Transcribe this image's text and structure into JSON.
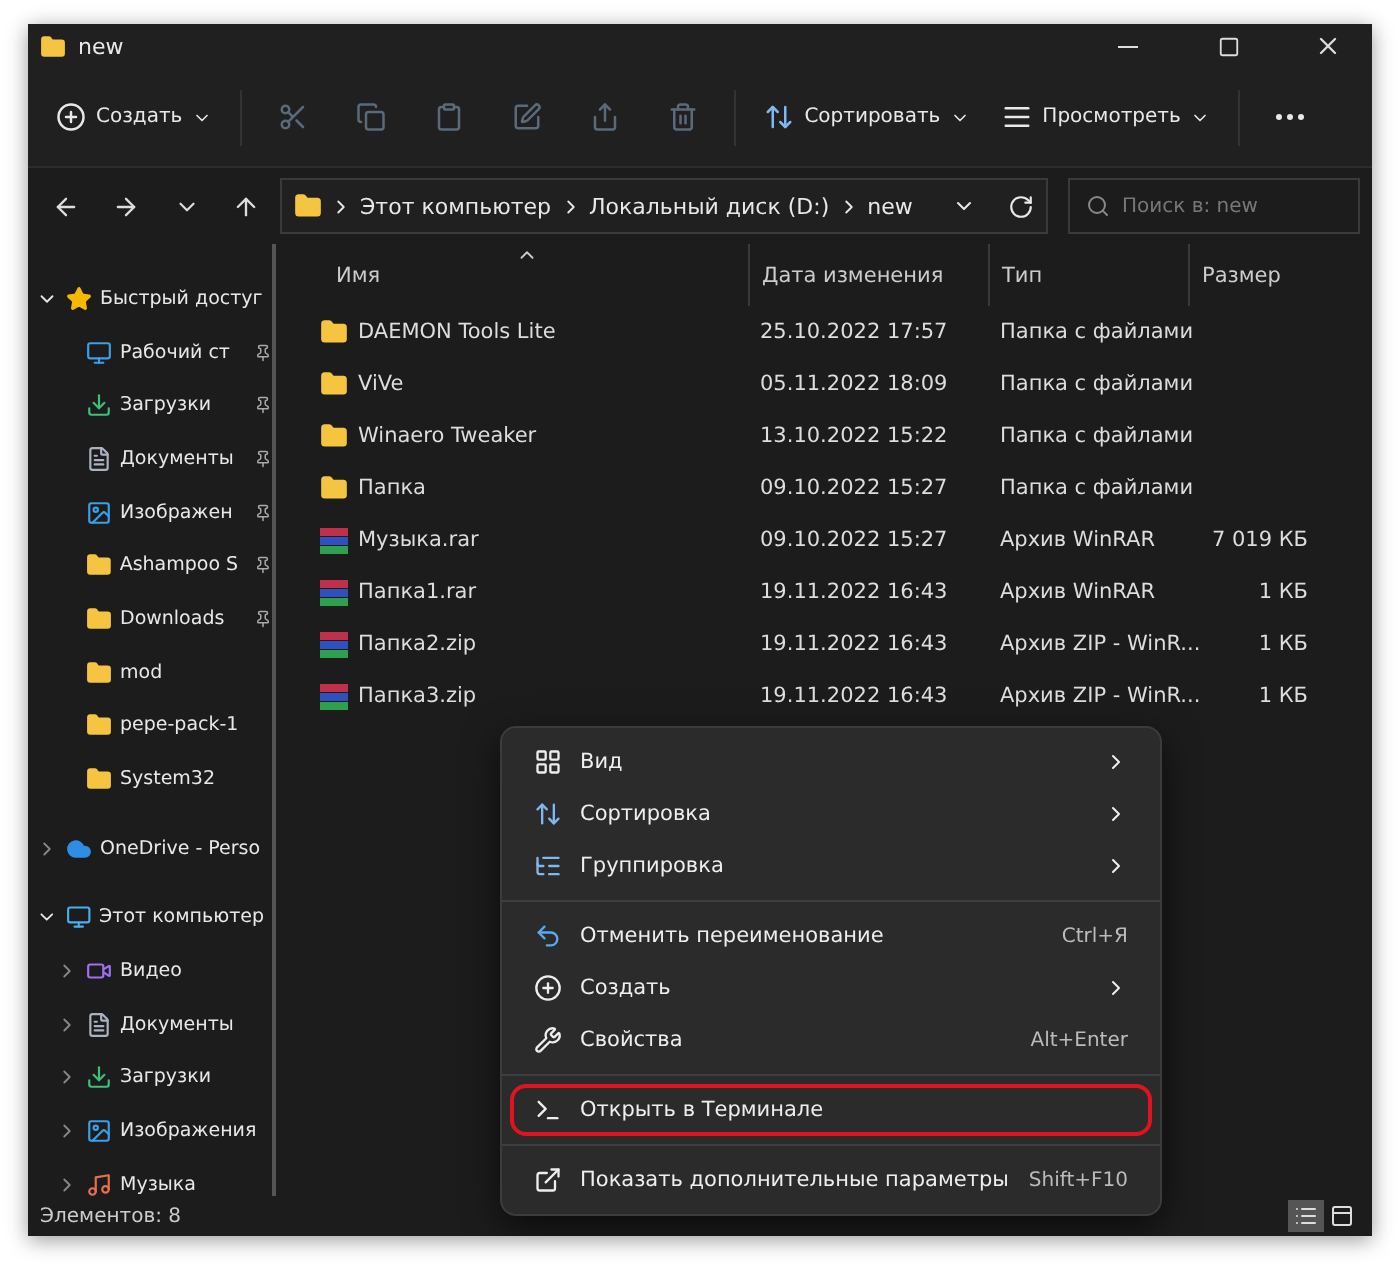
{
  "window": {
    "title": "new"
  },
  "toolbar": [
    {
      "kind": "new",
      "label": "Создать",
      "dropdown": true,
      "disabled": false
    },
    {
      "kind": "cut",
      "disabled": true
    },
    {
      "kind": "copy",
      "disabled": true
    },
    {
      "kind": "paste",
      "disabled": true
    },
    {
      "kind": "rename",
      "disabled": true
    },
    {
      "kind": "share",
      "disabled": true
    },
    {
      "kind": "delete",
      "disabled": true
    },
    {
      "kind": "sort",
      "label": "Сортировать",
      "dropdown": true,
      "disabled": false
    },
    {
      "kind": "view",
      "label": "Просмотреть",
      "dropdown": true,
      "disabled": false
    },
    {
      "kind": "more",
      "disabled": false
    }
  ],
  "address": {
    "path": [
      "Этот компьютер",
      "Локальный диск (D:)",
      "new"
    ],
    "search_placeholder": "Поиск в: new"
  },
  "sidebar": {
    "items": [
      {
        "kind": "star",
        "label": "Быстрый достуг",
        "expanded": true,
        "children": [
          {
            "kind": "desktop",
            "label": "Рабочий ст",
            "pinned": true
          },
          {
            "kind": "download",
            "label": "Загрузки",
            "pinned": true
          },
          {
            "kind": "documents",
            "label": "Документы",
            "pinned": true
          },
          {
            "kind": "pictures",
            "label": "Изображен",
            "pinned": true
          },
          {
            "kind": "folder",
            "label": "Ashampoo S",
            "pinned": true
          },
          {
            "kind": "folder",
            "label": "Downloads",
            "pinned": true
          },
          {
            "kind": "folder",
            "label": "mod",
            "pinned": false
          },
          {
            "kind": "folder",
            "label": "pepe-pack-1",
            "pinned": false
          },
          {
            "kind": "folder",
            "label": "System32",
            "pinned": false
          }
        ]
      },
      {
        "kind": "onedrive",
        "label": "OneDrive - Perso",
        "expanded": false
      },
      {
        "kind": "pc",
        "label": "Этот компьютер",
        "expanded": true,
        "children": [
          {
            "kind": "video",
            "label": "Видео",
            "expanded": false
          },
          {
            "kind": "documents",
            "label": "Документы",
            "expanded": false
          },
          {
            "kind": "download",
            "label": "Загрузки",
            "expanded": false
          },
          {
            "kind": "pictures",
            "label": "Изображения",
            "expanded": false
          },
          {
            "kind": "music",
            "label": "Музыка",
            "expanded": false
          }
        ]
      }
    ]
  },
  "table": {
    "columns": [
      "Имя",
      "Дата изменения",
      "Тип",
      "Размер"
    ],
    "rows": [
      {
        "kind": "folder",
        "name": "DAEMON Tools Lite",
        "date": "25.10.2022 17:57",
        "type": "Папка с файлами"
      },
      {
        "kind": "folder",
        "name": "ViVe",
        "date": "05.11.2022 18:09",
        "type": "Папка с файлами"
      },
      {
        "kind": "folder",
        "name": "Winaero Tweaker",
        "date": "13.10.2022 15:22",
        "type": "Папка с файлами"
      },
      {
        "kind": "folder",
        "name": "Папка",
        "date": "09.10.2022 15:27",
        "type": "Папка с файлами"
      },
      {
        "kind": "archive",
        "name": "Музыка.rar",
        "date": "09.10.2022 15:27",
        "type": "Архив WinRAR",
        "size": "7 019 КБ"
      },
      {
        "kind": "archive",
        "name": "Папка1.rar",
        "date": "19.11.2022 16:43",
        "type": "Архив WinRAR",
        "size": "1 КБ"
      },
      {
        "kind": "archive",
        "name": "Папка2.zip",
        "date": "19.11.2022 16:43",
        "type": "Архив ZIP - WinR...",
        "size": "1 КБ"
      },
      {
        "kind": "archive",
        "name": "Папка3.zip",
        "date": "19.11.2022 16:43",
        "type": "Архив ZIP - WinR...",
        "size": "1 КБ"
      }
    ]
  },
  "context_menu": {
    "groups": [
      [
        {
          "kind": "view",
          "label": "Вид",
          "submenu": true,
          "highlighted": false
        },
        {
          "kind": "sort",
          "label": "Сортировка",
          "submenu": true,
          "highlighted": false
        },
        {
          "kind": "group",
          "label": "Группировка",
          "submenu": true,
          "highlighted": false
        }
      ],
      [
        {
          "kind": "undo",
          "label": "Отменить переименование",
          "shortcut": "Ctrl+Я",
          "submenu": false,
          "highlighted": false
        },
        {
          "kind": "new",
          "label": "Создать",
          "submenu": true,
          "highlighted": false
        },
        {
          "kind": "properties",
          "label": "Свойства",
          "shortcut": "Alt+Enter",
          "submenu": false,
          "highlighted": false
        }
      ],
      [
        {
          "kind": "terminal",
          "label": "Открыть в Терминале",
          "submenu": false,
          "highlighted": true
        }
      ],
      [
        {
          "kind": "more",
          "label": "Показать дополнительные параметры",
          "shortcut": "Shift+F10",
          "submenu": false,
          "highlighted": false
        }
      ]
    ]
  },
  "status_bar": {
    "count": "Элементов: 8",
    "views": [
      {
        "kind": "details",
        "selected": true
      },
      {
        "kind": "tiles",
        "selected": false
      }
    ]
  }
}
